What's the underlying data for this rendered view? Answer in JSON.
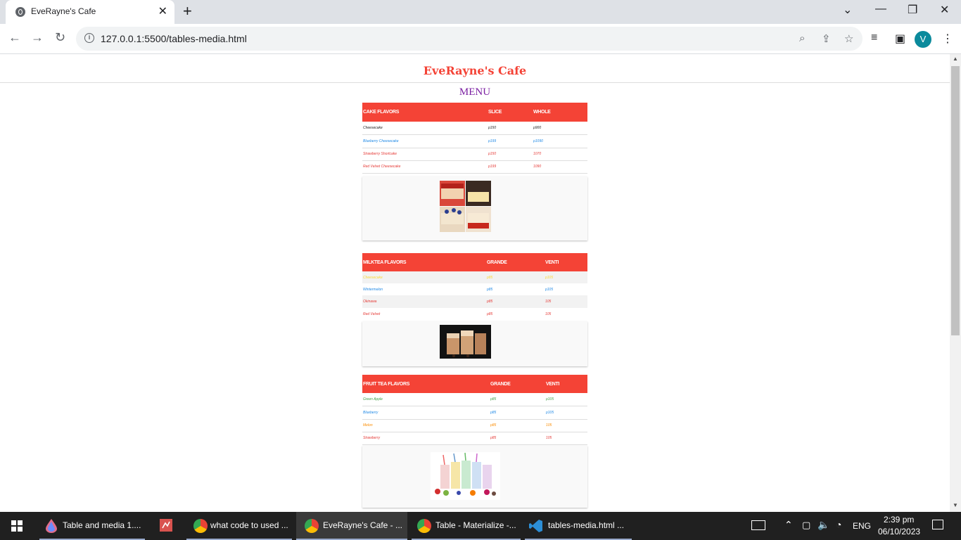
{
  "browser": {
    "tab_title": "EveRayne's Cafe",
    "url": "127.0.0.1:5500/tables-media.html",
    "avatar_letter": "V"
  },
  "page": {
    "site_title": "EveRayne's Cafe",
    "menu_title": "MENU"
  },
  "cake": {
    "headers": [
      "CAKE FLAVORS",
      "SLICE",
      "WHOLE"
    ],
    "rows": [
      [
        "Cheesecake",
        "p150",
        "p900"
      ],
      [
        "Blueberry Cheesecake",
        "p199",
        "p1090"
      ],
      [
        "Strawberry Shortcake",
        "p150",
        "1070"
      ],
      [
        "Red Velvet Cheesecake",
        "p199",
        "1090"
      ]
    ]
  },
  "milktea": {
    "headers": [
      "MILKTEA FLAVORS",
      "GRANDE",
      "VENTI"
    ],
    "rows": [
      [
        "Cheesecake",
        "p85",
        "p105"
      ],
      [
        "Wintermelon",
        "p85",
        "p105"
      ],
      [
        "Okinawa",
        "p85",
        "105"
      ],
      [
        "Red Velvet",
        "p85",
        "105"
      ]
    ]
  },
  "fruittea": {
    "headers": [
      "FRUIT TEA FLAVORS",
      "GRANDE",
      "VENTI"
    ],
    "rows": [
      [
        "Green Apple",
        "p85",
        "p105"
      ],
      [
        "Blueberry",
        "p85",
        "p105"
      ],
      [
        "Melon",
        "p85",
        "105"
      ],
      [
        "Strawberry",
        "p85",
        "105"
      ]
    ]
  },
  "taskbar": {
    "items": [
      "Table and media 1....",
      "what code to used ...",
      "EveRayne's Cafe - ...",
      "Table - Materialize -...",
      "tables-media.html ..."
    ],
    "language": "ENG",
    "time": "2:39 pm",
    "date": "06/10/2023"
  },
  "colors": {
    "accent": "#f44336",
    "menu_title": "#7b1fa2"
  }
}
